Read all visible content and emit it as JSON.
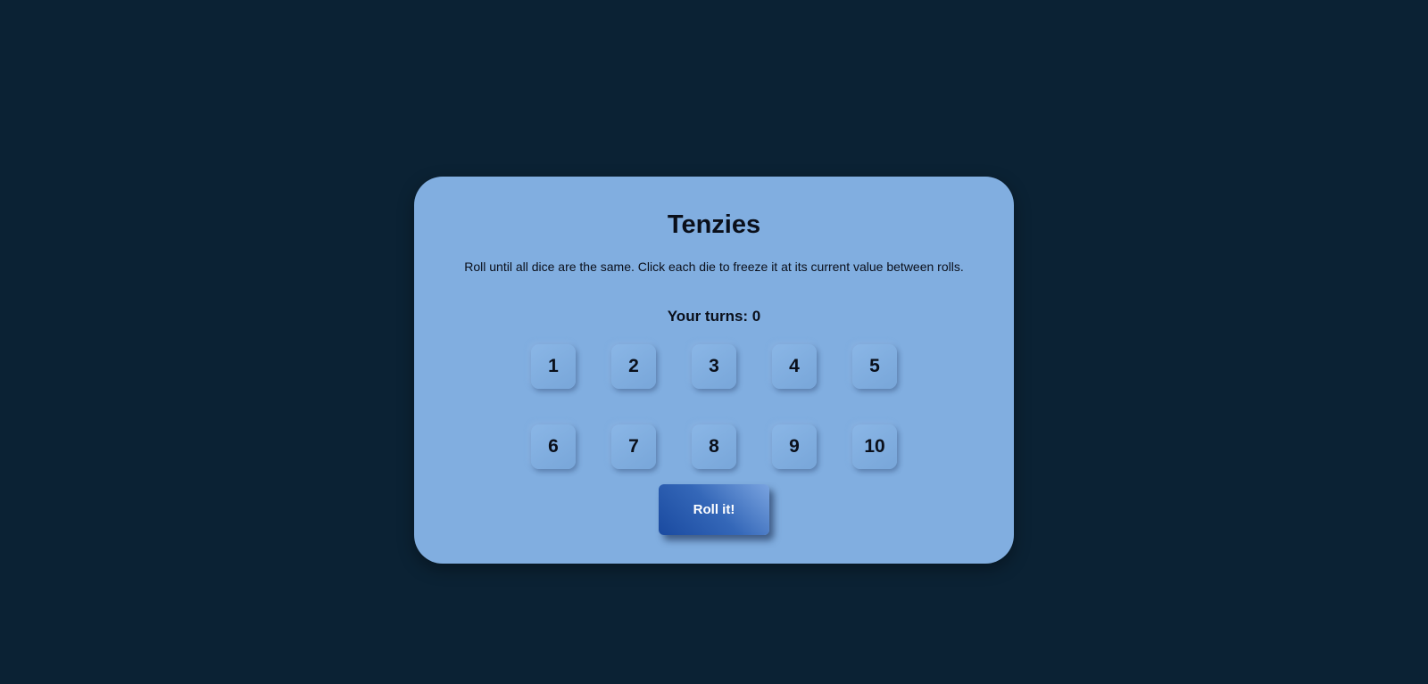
{
  "game": {
    "title": "Tenzies",
    "instructions": "Roll until all dice are the same. Click each die to freeze it at its current value between rolls.",
    "turns_label": "Your turns: 0",
    "roll_button_label": "Roll it!"
  },
  "dice": [
    "1",
    "2",
    "3",
    "4",
    "5",
    "6",
    "7",
    "8",
    "9",
    "10"
  ],
  "colors": {
    "background": "#0b2234",
    "card": "#81aee0",
    "button": "#1a4aa0",
    "text": "#0a0f1a"
  }
}
